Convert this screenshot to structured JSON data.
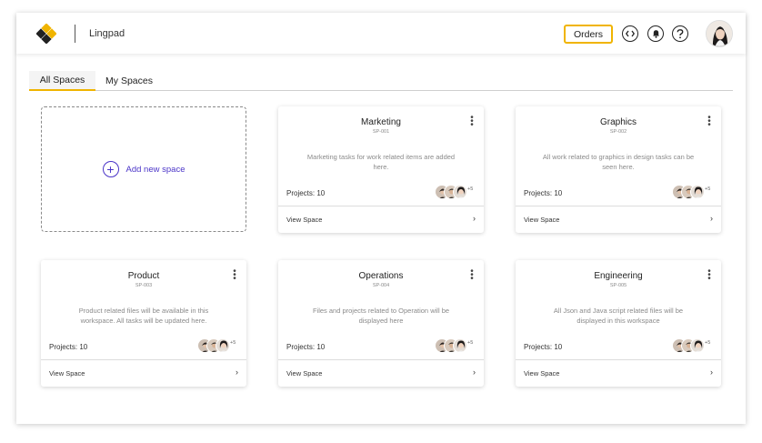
{
  "app": {
    "name": "Lingpad"
  },
  "header": {
    "orders_label": "Orders",
    "icons": [
      "code-icon",
      "bell-icon",
      "help-icon"
    ]
  },
  "tabs": [
    {
      "label": "All Spaces",
      "active": true
    },
    {
      "label": "My Spaces",
      "active": false
    }
  ],
  "add_space": {
    "label": "Add new space"
  },
  "spaces": [
    {
      "title": "Marketing",
      "code": "SP-001",
      "description": "Marketing tasks for work related items are added here.",
      "projects": "Projects: 10",
      "more": "+5",
      "link": "View Space"
    },
    {
      "title": "Graphics",
      "code": "SP-002",
      "description": "All work related to graphics in design tasks can be seen here.",
      "projects": "Projects: 10",
      "more": "+5",
      "link": "View Space"
    },
    {
      "title": "Product",
      "code": "SP-003",
      "description": "Product related files will be available in this workspace. All tasks will be updated here.",
      "projects": "Projects: 10",
      "more": "+5",
      "link": "View Space"
    },
    {
      "title": "Operations",
      "code": "SP-004",
      "description": "Files and projects related to Operation will be displayed here",
      "projects": "Projects: 10",
      "more": "+5",
      "link": "View Space"
    },
    {
      "title": "Engineering",
      "code": "SP-005",
      "description": "All Json and Java script related files will be displayed in this workspace",
      "projects": "Projects: 10",
      "more": "+5",
      "link": "View Space"
    }
  ],
  "colors": {
    "accent": "#f0b400",
    "link": "#4b35c8",
    "text": "#222222",
    "muted": "#8a8a8a"
  }
}
